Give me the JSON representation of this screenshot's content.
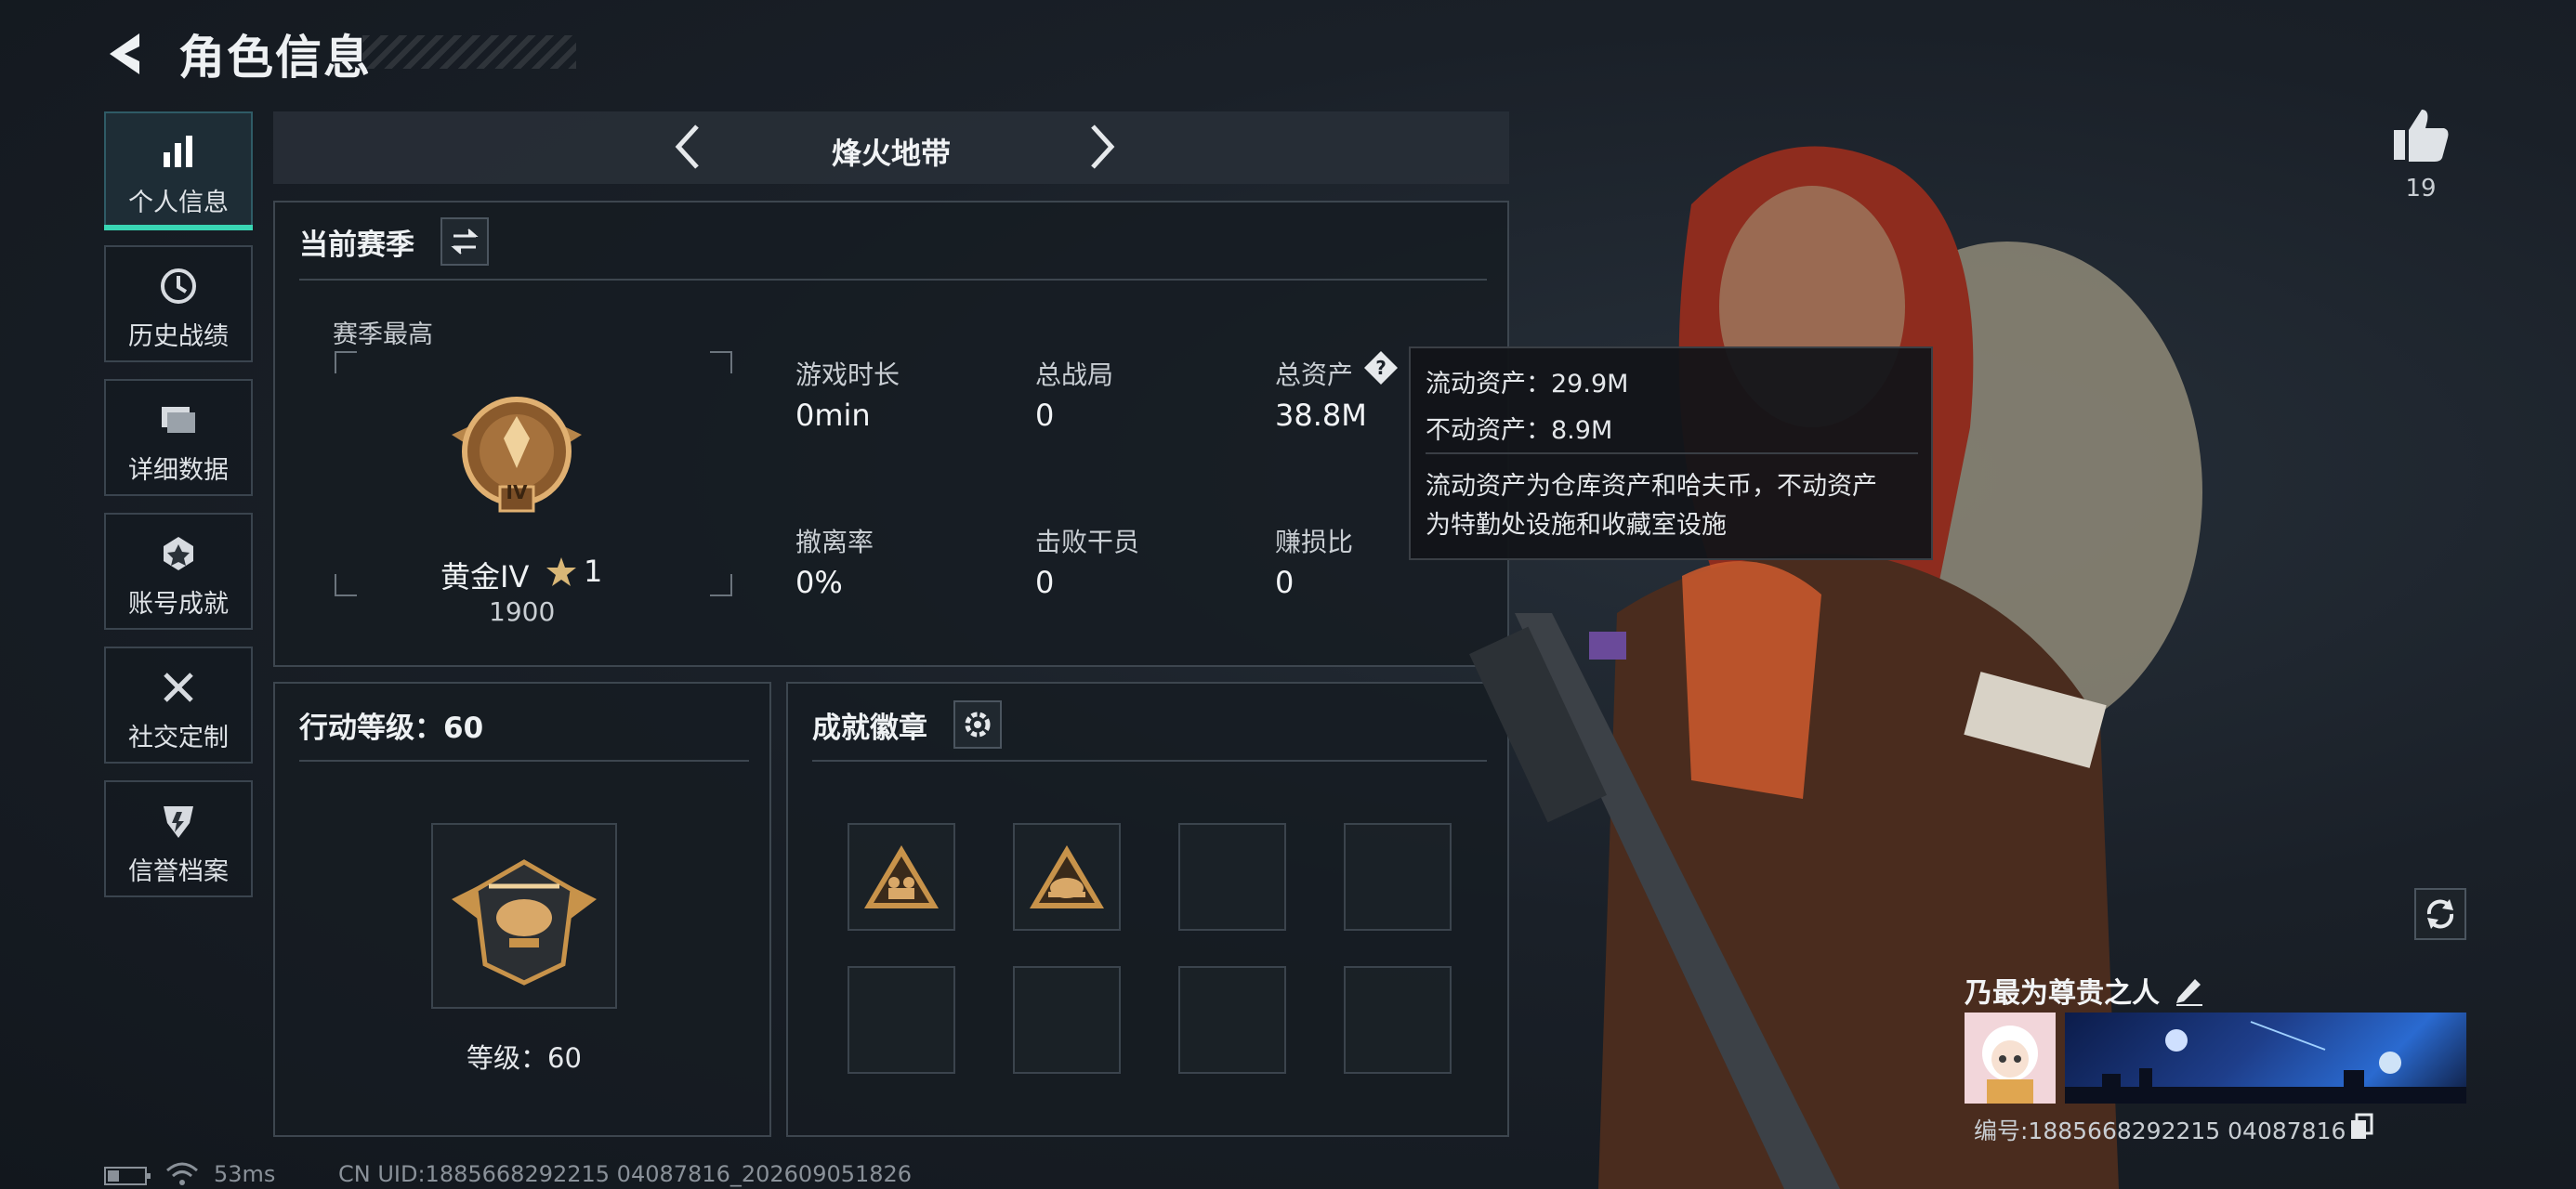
{
  "header": {
    "title": "角色信息"
  },
  "sidebar": {
    "items": [
      {
        "label": "个人信息",
        "icon": "bar-chart-icon",
        "active": true
      },
      {
        "label": "历史战绩",
        "icon": "clock-icon",
        "active": false
      },
      {
        "label": "详细数据",
        "icon": "folder-icon",
        "active": false
      },
      {
        "label": "账号成就",
        "icon": "medal-icon",
        "active": false
      },
      {
        "label": "社交定制",
        "icon": "wrench-icon",
        "active": false
      },
      {
        "label": "信誉档案",
        "icon": "shield-icon",
        "active": false
      }
    ]
  },
  "mode_tab": {
    "label": "烽火地带"
  },
  "season": {
    "title": "当前赛季",
    "best_label": "赛季最高",
    "rank_name": "黄金IV",
    "rank_stars": "1",
    "rank_score": "1900",
    "stats": [
      {
        "label": "游戏时长",
        "value": "0min"
      },
      {
        "label": "总战局",
        "value": "0"
      },
      {
        "label": "总资产",
        "value": "38.8M"
      },
      {
        "label": "撤离率",
        "value": "0%"
      },
      {
        "label": "击败干员",
        "value": "0"
      },
      {
        "label": "赚损比",
        "value": "0"
      }
    ]
  },
  "tooltip": {
    "liquid": "流动资产：29.9M",
    "fixed": "不动资产：8.9M",
    "desc_line1": "流动资产为仓库资产和哈夫币，不动资产",
    "desc_line2": "为特勤处设施和收藏室设施"
  },
  "action_level": {
    "title": "行动等级：60",
    "level_text": "等级：60"
  },
  "achievements": {
    "title": "成就徽章"
  },
  "likes": {
    "count": "19"
  },
  "player": {
    "name": "乃最为尊贵之人",
    "id_text": "编号:1885668292215 04087816"
  },
  "status_bar": {
    "ping": "53ms",
    "uid": "CN UID:1885668292215 04087816_202609051826"
  },
  "colors": {
    "accent": "#39d6b4",
    "gold": "#c8934a"
  }
}
